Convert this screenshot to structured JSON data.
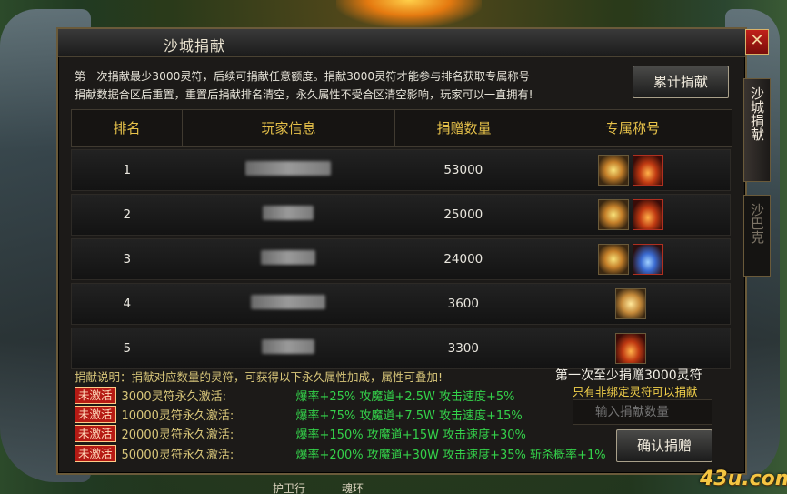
{
  "window": {
    "title": "沙城捐献",
    "close_label": "✕"
  },
  "intro": {
    "line1": "第一次捐献最少3000灵符，后续可捐献任意额度。捐献3000灵符才能参与排名获取专属称号",
    "line2": "捐献数据合区后重置，重置后捐献排名清空，永久属性不受合区清空影响，玩家可以一直拥有!"
  },
  "buttons": {
    "cumulative": "累计捐献",
    "confirm": "确认捐赠"
  },
  "table": {
    "headers": [
      "排名",
      "玩家信息",
      "捐赠数量",
      "专属称号"
    ],
    "rows": [
      {
        "rank": "1",
        "amount": "53000",
        "icons": [
          "gold-wing-title-icon",
          "red-flame-title-icon"
        ]
      },
      {
        "rank": "2",
        "amount": "25000",
        "icons": [
          "gold-wing-title-icon",
          "red-flame-title-icon"
        ]
      },
      {
        "rank": "3",
        "amount": "24000",
        "icons": [
          "gold-wing-title-icon",
          "blue-flame-title-icon"
        ]
      },
      {
        "rank": "4",
        "amount": "3600",
        "icons": [
          "gold-wing-title-icon"
        ]
      },
      {
        "rank": "5",
        "amount": "3300",
        "icons": [
          "orange-wing-title-icon"
        ]
      }
    ]
  },
  "explain": "捐献说明：捐献对应数量的灵符，可获得以下永久属性加成，属性可叠加!",
  "tiers": [
    {
      "badge": "未激活",
      "label": "3000灵符永久激活:",
      "attr": "爆率+25% 攻魔道+2.5W 攻击速度+5%"
    },
    {
      "badge": "未激活",
      "label": "10000灵符永久激活:",
      "attr": "爆率+75% 攻魔道+7.5W 攻击速度+15%"
    },
    {
      "badge": "未激活",
      "label": "20000灵符永久激活:",
      "attr": "爆率+150% 攻魔道+15W 攻击速度+30%"
    },
    {
      "badge": "未激活",
      "label": "50000灵符永久激活:",
      "attr": "爆率+200% 攻魔道+30W 攻击速度+35% 斩杀概率+1%"
    }
  ],
  "donate": {
    "min_note": "第一次至少捐赠3000灵符",
    "bind_note": "只有非绑定灵符可以捐献",
    "placeholder": "输入捐献数量"
  },
  "side_tabs": [
    "沙城捐献",
    "沙巴克"
  ],
  "bottom_tabs": [
    "护卫行",
    "魂环"
  ],
  "watermark": "43u.com"
}
